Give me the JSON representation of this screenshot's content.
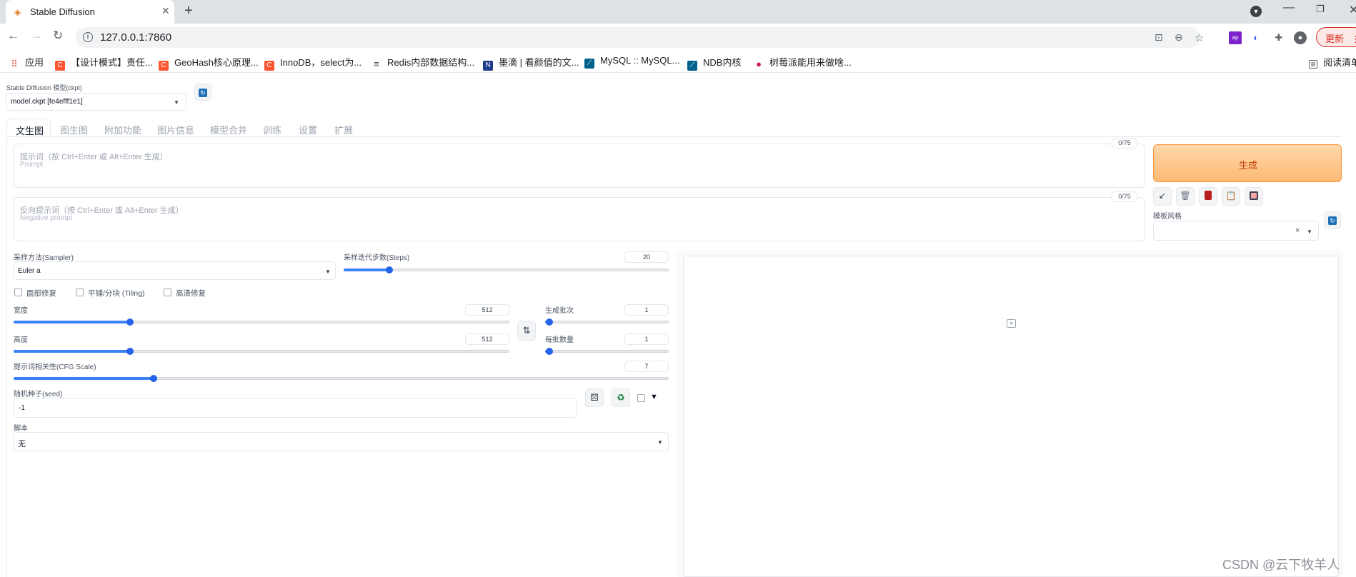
{
  "browser": {
    "tab_title": "Stable Diffusion",
    "url": "127.0.0.1:7860",
    "update_label": "更新",
    "bookmarks": [
      {
        "label": "应用",
        "icon": "apps-grid-icon",
        "color": "#ea4335"
      },
      {
        "label": "【设计模式】责任...",
        "icon": "csdn-icon",
        "color": "#fc5531"
      },
      {
        "label": "GeoHash核心原理...",
        "icon": "csdn-icon",
        "color": "#fc5531"
      },
      {
        "label": "InnoDB，select为...",
        "icon": "csdn-icon",
        "color": "#fc5531"
      },
      {
        "label": "Redis内部数据结构...",
        "icon": "stack-icon",
        "color": "#3c4043"
      },
      {
        "label": "墨滴 | 看颜值的文...",
        "icon": "mdnice-icon",
        "color": "#1e3a8a"
      },
      {
        "label": "MySQL :: MySQL...",
        "icon": "mysql-icon",
        "color": "#00618a"
      },
      {
        "label": "NDB内核",
        "icon": "mysql-icon",
        "color": "#00618a"
      },
      {
        "label": "树莓派能用来做啥...",
        "icon": "raspberry-icon",
        "color": "#c51a4a"
      }
    ],
    "reading_list": "阅读清单"
  },
  "model": {
    "label": "Stable Diffusion 模型(ckpt)",
    "value": "model.ckpt [fe4efff1e1]"
  },
  "tabs": [
    "文生图",
    "图生图",
    "附加功能",
    "图片信息",
    "模型合并",
    "训练",
    "设置",
    "扩展"
  ],
  "prompt": {
    "counter": "0/75",
    "placeholder_main": "提示词（按 Ctrl+Enter 或 Alt+Enter 生成）",
    "placeholder_sub": "Prompt"
  },
  "negative_prompt": {
    "counter": "0/75",
    "placeholder_main": "反向提示词（按 Ctrl+Enter 或 Alt+Enter 生成）",
    "placeholder_sub": "Negative prompt"
  },
  "generate": {
    "label": "生成",
    "color": "#fb923c"
  },
  "style": {
    "label": "模板风格",
    "clear": "×"
  },
  "sampler": {
    "label": "采样方法(Sampler)",
    "value": "Euler a"
  },
  "steps": {
    "label": "采样迭代步数(Steps)",
    "value": "20",
    "fraction": 0.13
  },
  "checkboxes": [
    "面部修复",
    "平铺/分块 (Tiling)",
    "高清修复"
  ],
  "width": {
    "label": "宽度",
    "value": "512",
    "fraction": 0.23
  },
  "height": {
    "label": "高度",
    "value": "512",
    "fraction": 0.23
  },
  "batch_count": {
    "label": "生成批次",
    "value": "1",
    "fraction": 0.0
  },
  "batch_size": {
    "label": "每批数量",
    "value": "1",
    "fraction": 0.0
  },
  "cfg": {
    "label": "提示词相关性(CFG Scale)",
    "value": "7",
    "fraction": 0.21
  },
  "seed": {
    "label": "随机种子(seed)",
    "value": "-1"
  },
  "script": {
    "label": "脚本",
    "value": "无"
  },
  "watermark": "CSDN @云下牧羊人"
}
